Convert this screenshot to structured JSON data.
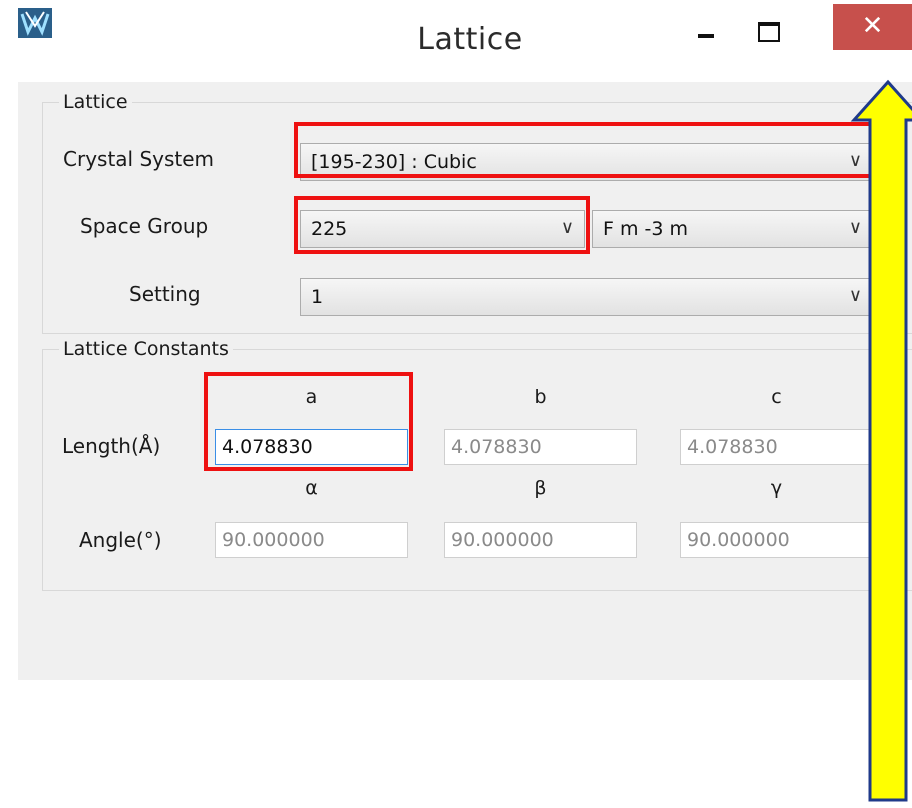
{
  "window": {
    "title": "Lattice",
    "close_glyph": "✕"
  },
  "lattice_group": {
    "title": "Lattice",
    "crystal_system_label": "Crystal System",
    "crystal_system_value": "[195-230] : Cubic",
    "space_group_label": "Space Group",
    "space_group_number": "225",
    "space_group_symbol": "F m -3 m",
    "setting_label": "Setting",
    "setting_value": "1"
  },
  "constants_group": {
    "title": "Lattice Constants",
    "length_label": "Length(Å)",
    "angle_label": "Angle(°)",
    "length_headers": [
      "a",
      "b",
      "c"
    ],
    "angle_headers": [
      "α",
      "β",
      "γ"
    ],
    "length_values": [
      "4.078830",
      "4.078830",
      "4.078830"
    ],
    "angle_values": [
      "90.000000",
      "90.000000",
      "90.000000"
    ]
  },
  "icons": {
    "app": "app-logo-icon",
    "dropdown": "chevron-down-icon",
    "annotation_arrow": "up-arrow-annotation"
  },
  "colors": {
    "highlight": "#ee1111",
    "close_button": "#c7504c",
    "arrow_fill": "#ffff00",
    "arrow_outline": "#1f3a8a"
  }
}
